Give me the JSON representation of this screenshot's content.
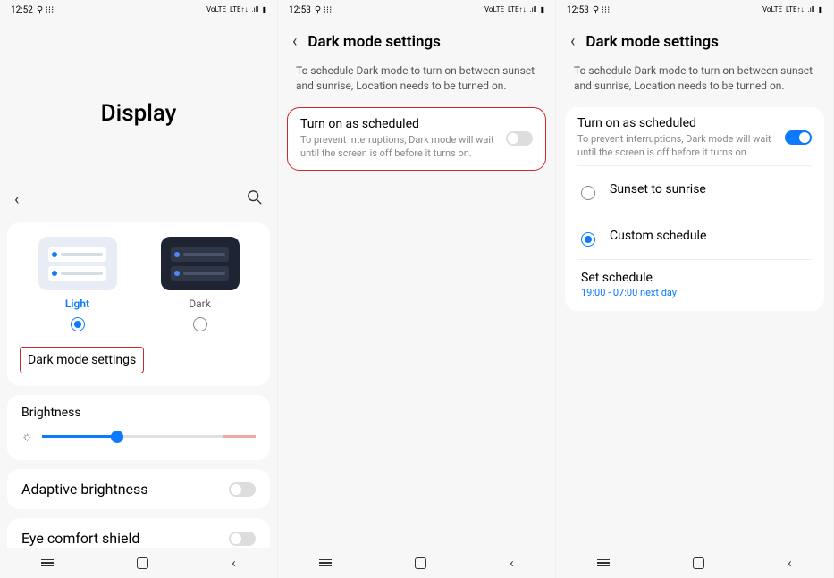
{
  "statusbar": {
    "time1": "12:52",
    "time2": "12:53",
    "icons_left": "⚲ ⁝⁝⁝",
    "icons_right_volte": "VoLTE",
    "icons_right_lte": "LTE↑↓",
    "icons_right_signal": ".ıll",
    "icons_right_battery": "▮"
  },
  "screen1": {
    "title": "Display",
    "theme_light": "Light",
    "theme_dark": "Dark",
    "dark_mode_settings": "Dark mode settings",
    "brightness": "Brightness",
    "adaptive_brightness": "Adaptive brightness",
    "eye_comfort": "Eye comfort shield"
  },
  "dark_settings": {
    "header": "Dark mode settings",
    "desc": "To schedule Dark mode to turn on between sunset and sunrise, Location needs to be turned on.",
    "turn_on_scheduled": "Turn on as scheduled",
    "turn_on_sub": "To prevent interruptions, Dark mode will wait until the screen is off before it turns on.",
    "sunset": "Sunset to sunrise",
    "custom": "Custom schedule",
    "set_schedule": "Set schedule",
    "schedule_value": "19:00 - 07:00 next day"
  }
}
